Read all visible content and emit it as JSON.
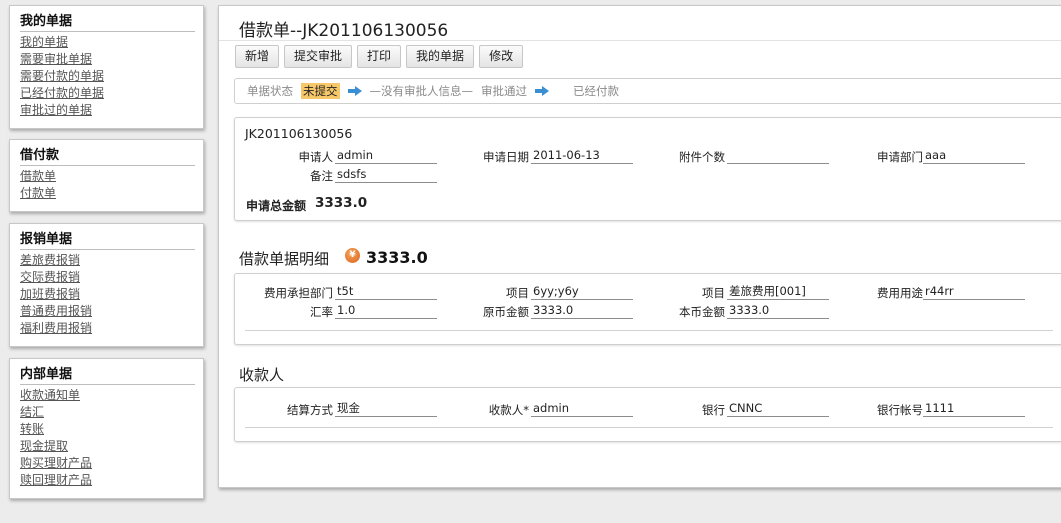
{
  "sidebar": {
    "groups": [
      {
        "title": "我的单据",
        "items": [
          "我的单据",
          "需要审批单据",
          "需要付款的单据",
          "已经付款的单据",
          "审批过的单据"
        ]
      },
      {
        "title": "借付款",
        "items": [
          "借款单",
          "付款单"
        ]
      },
      {
        "title": "报销单据",
        "items": [
          "差旅费报销",
          "交际费报销",
          "加班费报销",
          "普通费用报销",
          "福利费用报销"
        ]
      },
      {
        "title": "内部单据",
        "items": [
          "收款通知单",
          "结汇",
          "转账",
          "现金提取",
          "购买理财产品",
          "赎回理财产品"
        ]
      }
    ]
  },
  "main": {
    "title": "借款单--JK201106130056",
    "toolbar": [
      "新增",
      "提交审批",
      "打印",
      "我的单据",
      "修改"
    ],
    "status": {
      "label": "单据状态",
      "current": "未提交",
      "approver": "—没有审批人信息—",
      "step2": "审批通过",
      "step3": "已经付款"
    },
    "header": {
      "doc_no": "JK201106130056",
      "applicant_label": "申请人",
      "applicant": "admin",
      "date_label": "申请日期",
      "date": "2011-06-13",
      "attach_label": "附件个数",
      "attach": "",
      "dept_label": "申请部门",
      "dept": "aaa",
      "remark_label": "备注",
      "remark": "sdsfs",
      "total_label": "申请总金额",
      "total": "3333.0"
    },
    "detail": {
      "title": "借款单据明细",
      "amount": "3333.0",
      "cost_dept_label": "费用承担部门",
      "cost_dept": "t5t",
      "project_label": "项目",
      "project": "6yy;y6y",
      "item_label": "项目",
      "item": "差旅费用[001]",
      "usage_label": "费用用途",
      "usage": "r44rr",
      "rate_label": "汇率",
      "rate": "1.0",
      "orig_amount_label": "原币金额",
      "orig_amount": "3333.0",
      "local_amount_label": "本币金额",
      "local_amount": "3333.0"
    },
    "payee": {
      "title": "收款人",
      "method_label": "结算方式",
      "method": "现金",
      "payee_label": "收款人*",
      "payee": "admin",
      "bank_label": "银行",
      "bank": "CNNC",
      "account_label": "银行帐号",
      "account": "1111"
    }
  }
}
